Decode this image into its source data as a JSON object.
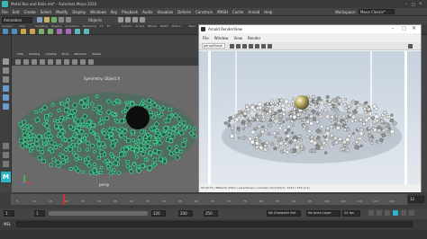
{
  "title_bar": {
    "text": "Autodesk Maya 2020: C:\\Users\\PHIL R\\Documents\\maya\\projects\\default\\scenes\\Bless Metal Box and Balls.mb -- MASH1_ReprotoMesh1",
    "title_short": "Metal Box and Balls.mb* - Autodesk Maya 2020"
  },
  "menu": {
    "items": [
      "File",
      "Edit",
      "Create",
      "Select",
      "Modify",
      "Display",
      "Windows",
      "Key",
      "Playback",
      "Audio",
      "Visualize",
      "Deform",
      "Constrain",
      "MASH",
      "Cache",
      "Arnold",
      "Help"
    ],
    "workspace_label": "Workspace:",
    "workspace_value": "Maya Classic*"
  },
  "status_line": {
    "mode": "Animation",
    "objects_label": "Objects"
  },
  "shelf": {
    "tabs": [
      "Curves / Surfaces",
      "Poly Modeling",
      "Sculpting",
      "Rigging",
      "Animation",
      "Rendering",
      "FX",
      "FX Caching",
      "Custom",
      "Arnold",
      "Bifrost",
      "MASH",
      "Motion Graphics",
      "XGen"
    ]
  },
  "viewport": {
    "menu": [
      "View",
      "Shading",
      "Lighting",
      "Show",
      "Renderer",
      "Panels"
    ],
    "symmetry_label": "Symmetry: Object X",
    "camera_label": "persp"
  },
  "render_view": {
    "title": "Arnold RenderView",
    "menu": [
      "File",
      "Window",
      "View",
      "Render"
    ],
    "camera": "perspShape",
    "status": "00:00:37 | 886Gmb 256m | perspShape | samples 3/2/2/2/2/2 | 1024 x 576 (1:0)"
  },
  "timeline": {
    "ticks": [
      "5",
      "10",
      "15",
      "20",
      "25",
      "30",
      "35",
      "40",
      "45",
      "50",
      "55",
      "60",
      "65",
      "70",
      "75",
      "80",
      "85",
      "90",
      "95",
      "100",
      "105",
      "110",
      "115",
      "120"
    ],
    "current_frame": "12"
  },
  "range": {
    "start": "1",
    "start_inner": "1",
    "end_inner": "120",
    "end": "200",
    "end2": "250",
    "character_set": "No Character Set",
    "anim_layer": "No Anim Layer",
    "fps": "24 fps"
  },
  "cmd": {
    "label": "MEL"
  },
  "colors": {
    "particle_green": "#3fdc9a",
    "render_bg": "#d4dde6",
    "accent_blue": "#5fa8d8"
  }
}
